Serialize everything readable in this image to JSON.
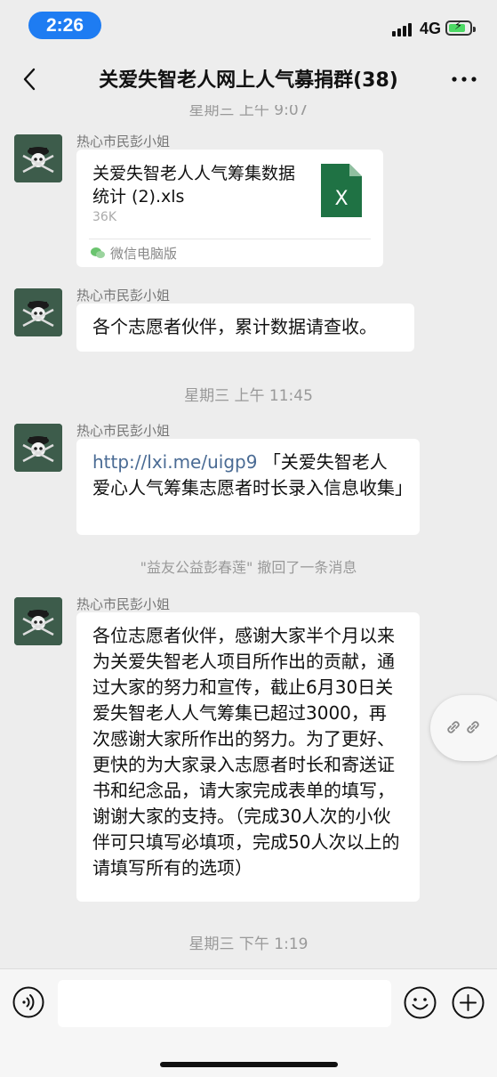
{
  "status_bar": {
    "time": "2:26",
    "network": "4G",
    "time_pill_color": "#1e7cf2",
    "battery_charging": true
  },
  "nav": {
    "title": "关爱失智老人网上人气募捐群(38)",
    "back_icon": "chevron-left-icon",
    "more_icon": "more-dots-icon"
  },
  "chat": {
    "top_time_partial": "星期三 上午 9:07",
    "messages": [
      {
        "sender": "热心市民彭小姐",
        "type": "file",
        "file_name": "关爱失智老人人气筹集数据统计 (2).xls",
        "file_size": "36K",
        "source": "微信电脑版"
      },
      {
        "sender": "热心市民彭小姐",
        "type": "text",
        "text": "各个志愿者伙伴，累计数据请查收。"
      }
    ],
    "time_2": "星期三 上午 11:45",
    "link_message": {
      "sender": "热心市民彭小姐",
      "link": "http://lxi.me/uigp9",
      "text": "「关爱失智老人爱心人气筹集志愿者时长录入信息收集」"
    },
    "recall_notice": "\"益友公益彭春莲\" 撤回了一条消息",
    "long_message": {
      "sender": "热心市民彭小姐",
      "text": "各位志愿者伙伴，感谢大家半个月以来为关爱失智老人项目所作出的贡献，通过大家的努力和宣传，截止6月30日关爱失智老人人气筹集已超过3000，再次感谢大家所作出的努力。为了更好、更快的为大家录入志愿者时长和寄送证书和纪念品，请大家完成表单的填写，谢谢大家的支持。（完成30人次的小伙伴可只填写必填项，完成50人次以上的请填写所有的选项）"
    },
    "time_3": "星期三 下午 1:19"
  },
  "input_bar": {
    "placeholder": "",
    "voice_icon": "voice-icon",
    "emoji_icon": "emoji-icon",
    "plus_icon": "plus-icon"
  },
  "colors": {
    "link": "#4a6b94",
    "excel_green": "#1f7244",
    "background": "#ededed"
  }
}
